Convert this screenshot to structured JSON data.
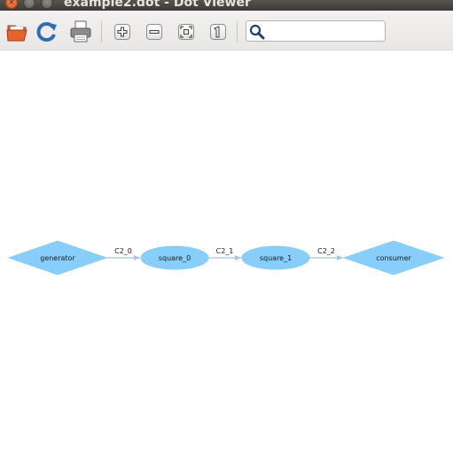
{
  "window": {
    "title": "example2.dot - Dot Viewer"
  },
  "toolbar": {
    "buttons": [
      {
        "icon": "open-folder-icon"
      },
      {
        "icon": "reload-icon"
      },
      {
        "icon": "print-icon"
      },
      {
        "icon": "zoom-in-icon"
      },
      {
        "icon": "zoom-out-icon"
      },
      {
        "icon": "zoom-fit-icon"
      },
      {
        "icon": "zoom-100-icon"
      }
    ],
    "search": {
      "value": "",
      "placeholder": "",
      "icon": "search-icon"
    }
  },
  "graph": {
    "node_color": "#87cefa",
    "edge_color": "#a9c6d8",
    "nodes": [
      {
        "id": "generator",
        "label": "generator",
        "shape": "diamond"
      },
      {
        "id": "square_0",
        "label": "square_0",
        "shape": "ellipse"
      },
      {
        "id": "square_1",
        "label": "square_1",
        "shape": "ellipse"
      },
      {
        "id": "consumer",
        "label": "consumer",
        "shape": "diamond"
      }
    ],
    "edges": [
      {
        "from": "generator",
        "to": "square_0",
        "label": "C2_0"
      },
      {
        "from": "square_0",
        "to": "square_1",
        "label": "C2_1"
      },
      {
        "from": "square_1",
        "to": "consumer",
        "label": "C2_2"
      }
    ]
  }
}
